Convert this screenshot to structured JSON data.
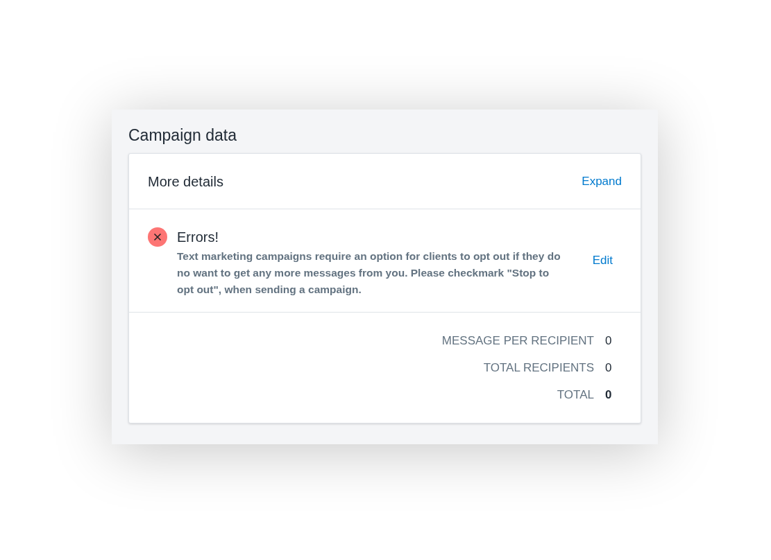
{
  "panel": {
    "title": "Campaign data"
  },
  "card": {
    "header": {
      "title": "More details",
      "action": "Expand"
    },
    "error": {
      "title": "Errors!",
      "message": "Text marketing campaigns require an option for clients to opt out if they do no want to get any more messages from you. Please checkmark \"Stop to opt out\", when sending a campaign.",
      "action": "Edit"
    },
    "summary": [
      {
        "kind": "line",
        "label": "MESSAGE PER RECIPIENT",
        "value": "0"
      },
      {
        "kind": "line",
        "label": "TOTAL RECIPIENTS",
        "value": "0"
      },
      {
        "kind": "total",
        "label": "TOTAL",
        "value": "0"
      }
    ]
  }
}
